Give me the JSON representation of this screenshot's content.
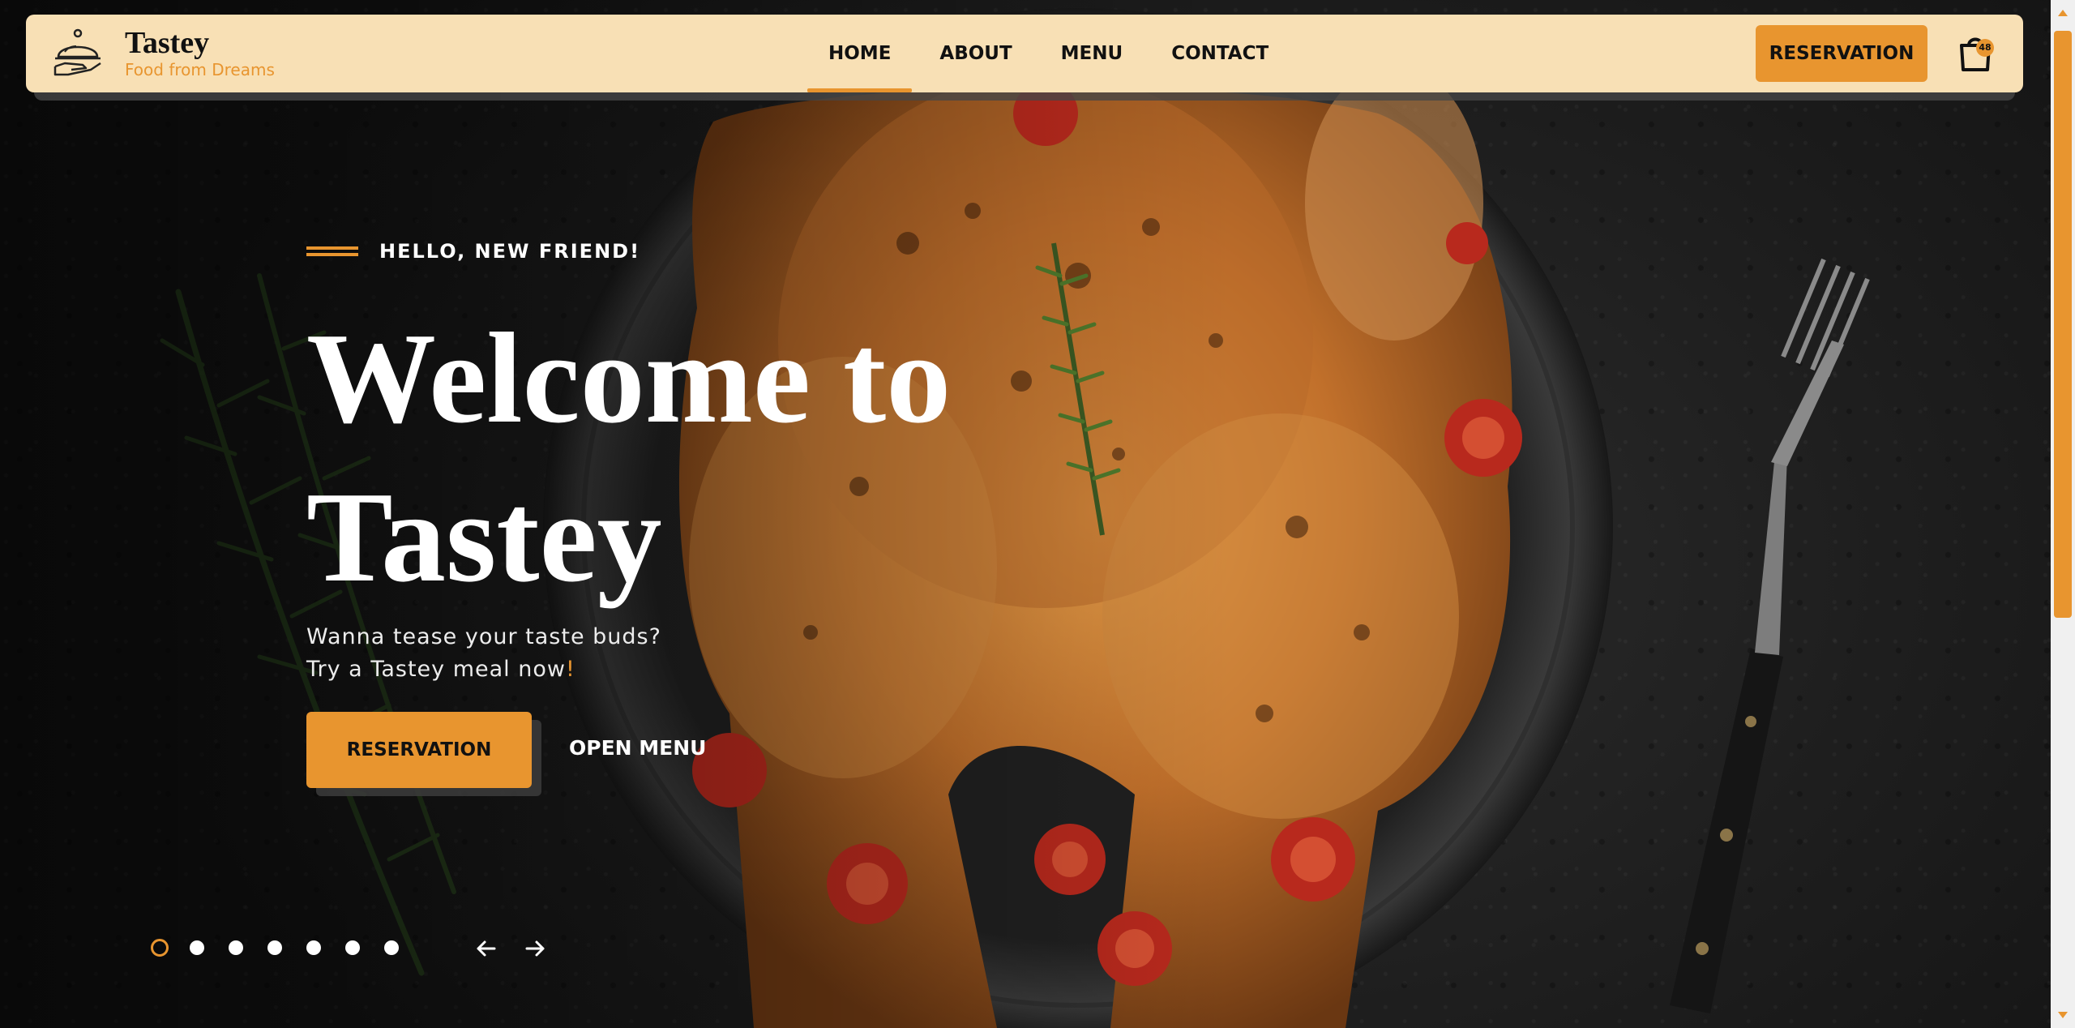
{
  "brand": {
    "name": "Tastey",
    "tagline": "Food from Dreams",
    "logo_icon": "cloche-serving-icon"
  },
  "nav": {
    "items": [
      {
        "label": "HOME",
        "active": true
      },
      {
        "label": "ABOUT",
        "active": false
      },
      {
        "label": "MENU",
        "active": false
      },
      {
        "label": "CONTACT",
        "active": false
      }
    ]
  },
  "header": {
    "reservation_label": "RESERVATION",
    "cart_icon": "shopping-bag-icon",
    "cart_count": "48"
  },
  "hero": {
    "eyebrow": "HELLO, NEW FRIEND!",
    "title_line1": "Welcome to",
    "title_line2": "Tastey",
    "subtitle_line1": "Wanna tease your taste buds?",
    "subtitle_line2": "Try a Tastey meal now",
    "subtitle_bang": "!",
    "primary_button": "RESERVATION",
    "secondary_link": "OPEN MENU"
  },
  "slider": {
    "slide_count": 7,
    "active_index": 0,
    "prev_icon": "arrow-left-icon",
    "next_icon": "arrow-right-icon"
  },
  "colors": {
    "accent": "#e8952f",
    "header_bg": "#f8e0b5",
    "dark_bg": "#1b1b1b"
  }
}
